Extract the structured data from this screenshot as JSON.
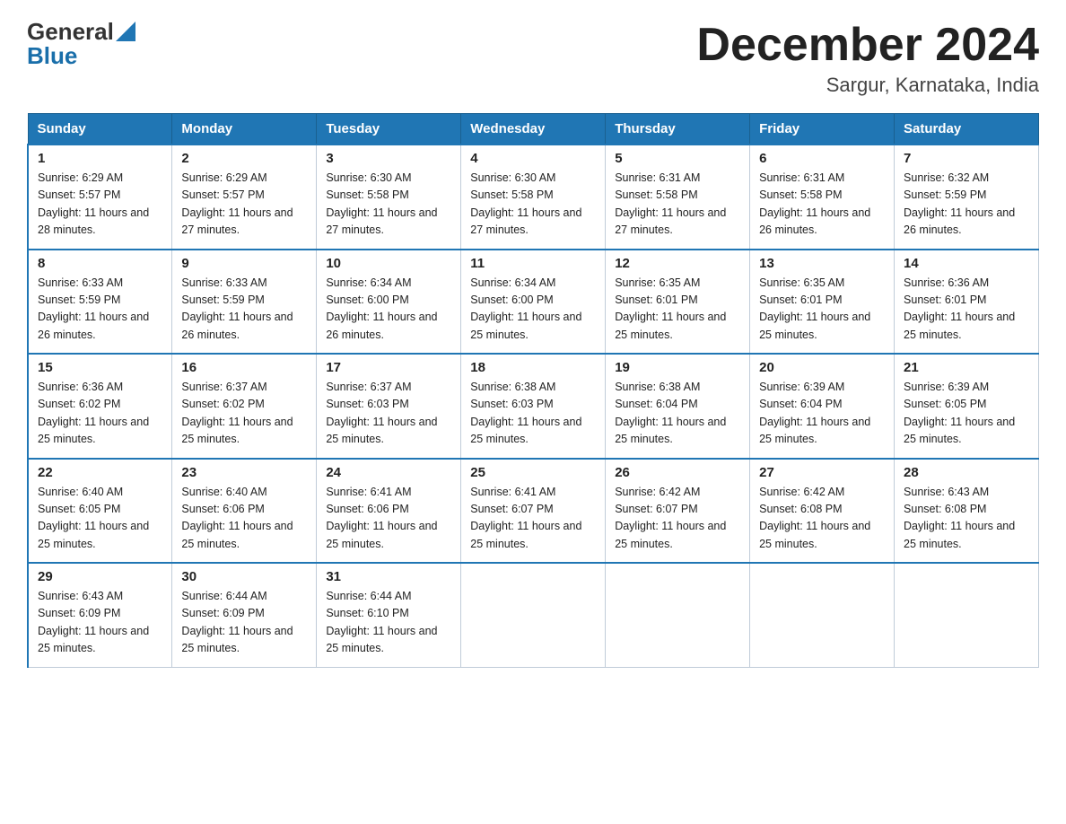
{
  "header": {
    "logo_general": "General",
    "logo_blue": "Blue",
    "month_title": "December 2024",
    "location": "Sargur, Karnataka, India"
  },
  "columns": [
    "Sunday",
    "Monday",
    "Tuesday",
    "Wednesday",
    "Thursday",
    "Friday",
    "Saturday"
  ],
  "weeks": [
    [
      {
        "day": "1",
        "sunrise": "6:29 AM",
        "sunset": "5:57 PM",
        "daylight": "11 hours and 28 minutes."
      },
      {
        "day": "2",
        "sunrise": "6:29 AM",
        "sunset": "5:57 PM",
        "daylight": "11 hours and 27 minutes."
      },
      {
        "day": "3",
        "sunrise": "6:30 AM",
        "sunset": "5:58 PM",
        "daylight": "11 hours and 27 minutes."
      },
      {
        "day": "4",
        "sunrise": "6:30 AM",
        "sunset": "5:58 PM",
        "daylight": "11 hours and 27 minutes."
      },
      {
        "day": "5",
        "sunrise": "6:31 AM",
        "sunset": "5:58 PM",
        "daylight": "11 hours and 27 minutes."
      },
      {
        "day": "6",
        "sunrise": "6:31 AM",
        "sunset": "5:58 PM",
        "daylight": "11 hours and 26 minutes."
      },
      {
        "day": "7",
        "sunrise": "6:32 AM",
        "sunset": "5:59 PM",
        "daylight": "11 hours and 26 minutes."
      }
    ],
    [
      {
        "day": "8",
        "sunrise": "6:33 AM",
        "sunset": "5:59 PM",
        "daylight": "11 hours and 26 minutes."
      },
      {
        "day": "9",
        "sunrise": "6:33 AM",
        "sunset": "5:59 PM",
        "daylight": "11 hours and 26 minutes."
      },
      {
        "day": "10",
        "sunrise": "6:34 AM",
        "sunset": "6:00 PM",
        "daylight": "11 hours and 26 minutes."
      },
      {
        "day": "11",
        "sunrise": "6:34 AM",
        "sunset": "6:00 PM",
        "daylight": "11 hours and 25 minutes."
      },
      {
        "day": "12",
        "sunrise": "6:35 AM",
        "sunset": "6:01 PM",
        "daylight": "11 hours and 25 minutes."
      },
      {
        "day": "13",
        "sunrise": "6:35 AM",
        "sunset": "6:01 PM",
        "daylight": "11 hours and 25 minutes."
      },
      {
        "day": "14",
        "sunrise": "6:36 AM",
        "sunset": "6:01 PM",
        "daylight": "11 hours and 25 minutes."
      }
    ],
    [
      {
        "day": "15",
        "sunrise": "6:36 AM",
        "sunset": "6:02 PM",
        "daylight": "11 hours and 25 minutes."
      },
      {
        "day": "16",
        "sunrise": "6:37 AM",
        "sunset": "6:02 PM",
        "daylight": "11 hours and 25 minutes."
      },
      {
        "day": "17",
        "sunrise": "6:37 AM",
        "sunset": "6:03 PM",
        "daylight": "11 hours and 25 minutes."
      },
      {
        "day": "18",
        "sunrise": "6:38 AM",
        "sunset": "6:03 PM",
        "daylight": "11 hours and 25 minutes."
      },
      {
        "day": "19",
        "sunrise": "6:38 AM",
        "sunset": "6:04 PM",
        "daylight": "11 hours and 25 minutes."
      },
      {
        "day": "20",
        "sunrise": "6:39 AM",
        "sunset": "6:04 PM",
        "daylight": "11 hours and 25 minutes."
      },
      {
        "day": "21",
        "sunrise": "6:39 AM",
        "sunset": "6:05 PM",
        "daylight": "11 hours and 25 minutes."
      }
    ],
    [
      {
        "day": "22",
        "sunrise": "6:40 AM",
        "sunset": "6:05 PM",
        "daylight": "11 hours and 25 minutes."
      },
      {
        "day": "23",
        "sunrise": "6:40 AM",
        "sunset": "6:06 PM",
        "daylight": "11 hours and 25 minutes."
      },
      {
        "day": "24",
        "sunrise": "6:41 AM",
        "sunset": "6:06 PM",
        "daylight": "11 hours and 25 minutes."
      },
      {
        "day": "25",
        "sunrise": "6:41 AM",
        "sunset": "6:07 PM",
        "daylight": "11 hours and 25 minutes."
      },
      {
        "day": "26",
        "sunrise": "6:42 AM",
        "sunset": "6:07 PM",
        "daylight": "11 hours and 25 minutes."
      },
      {
        "day": "27",
        "sunrise": "6:42 AM",
        "sunset": "6:08 PM",
        "daylight": "11 hours and 25 minutes."
      },
      {
        "day": "28",
        "sunrise": "6:43 AM",
        "sunset": "6:08 PM",
        "daylight": "11 hours and 25 minutes."
      }
    ],
    [
      {
        "day": "29",
        "sunrise": "6:43 AM",
        "sunset": "6:09 PM",
        "daylight": "11 hours and 25 minutes."
      },
      {
        "day": "30",
        "sunrise": "6:44 AM",
        "sunset": "6:09 PM",
        "daylight": "11 hours and 25 minutes."
      },
      {
        "day": "31",
        "sunrise": "6:44 AM",
        "sunset": "6:10 PM",
        "daylight": "11 hours and 25 minutes."
      },
      null,
      null,
      null,
      null
    ]
  ]
}
